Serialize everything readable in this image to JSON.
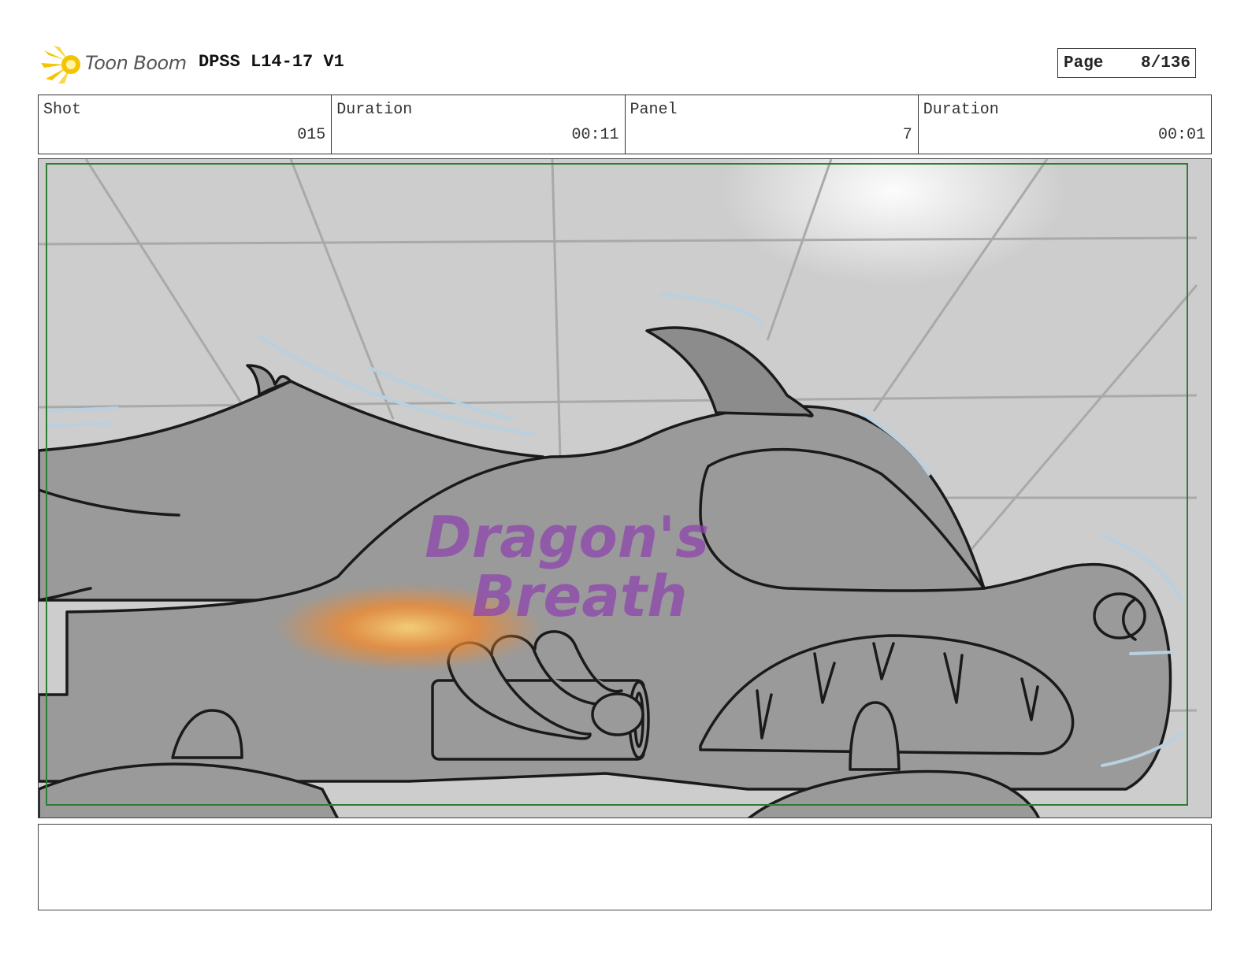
{
  "header": {
    "logo_text": "Toon Boom",
    "project_title": "DPSS L14-17 V1",
    "page_label": "Page",
    "page_value": "8/136"
  },
  "info": [
    {
      "label": "Shot",
      "value": "015"
    },
    {
      "label": "Duration",
      "value": "00:11"
    },
    {
      "label": "Panel",
      "value": "7"
    },
    {
      "label": "Duration",
      "value": "00:01"
    }
  ],
  "panel": {
    "sketch_text_line1": "Dragon's",
    "sketch_text_line2": "Breath"
  },
  "notes": {
    "text": ""
  },
  "colors": {
    "logo_accent": "#f5c400",
    "safe_frame": "#2e7d32",
    "lettering": "#8e44ad",
    "flame": "#f08a30",
    "car_body": "#9a9a9a",
    "background": "#cdcdcd"
  }
}
